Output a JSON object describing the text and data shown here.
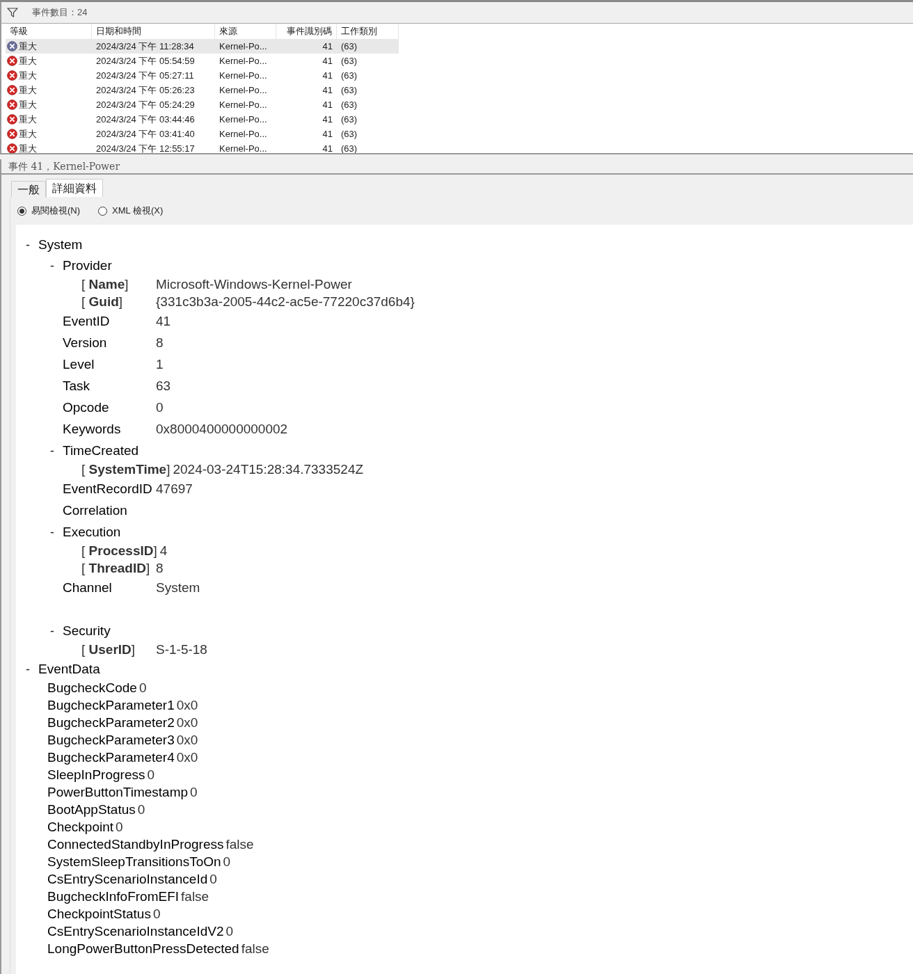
{
  "filter_bar": {
    "count_label": "事件數目：24"
  },
  "table": {
    "columns": [
      "等級",
      "日期和時間",
      "來源",
      "事件識別碼",
      "工作類別"
    ],
    "rows": [
      {
        "level": "重大",
        "datetime": "2024/3/24 下午 11:28:34",
        "source": "Kernel-Po...",
        "event_id": "41",
        "task": "(63)",
        "selected": true
      },
      {
        "level": "重大",
        "datetime": "2024/3/24 下午 05:54:59",
        "source": "Kernel-Po...",
        "event_id": "41",
        "task": "(63)",
        "selected": false
      },
      {
        "level": "重大",
        "datetime": "2024/3/24 下午 05:27:11",
        "source": "Kernel-Po...",
        "event_id": "41",
        "task": "(63)",
        "selected": false
      },
      {
        "level": "重大",
        "datetime": "2024/3/24 下午 05:26:23",
        "source": "Kernel-Po...",
        "event_id": "41",
        "task": "(63)",
        "selected": false
      },
      {
        "level": "重大",
        "datetime": "2024/3/24 下午 05:24:29",
        "source": "Kernel-Po...",
        "event_id": "41",
        "task": "(63)",
        "selected": false
      },
      {
        "level": "重大",
        "datetime": "2024/3/24 下午 03:44:46",
        "source": "Kernel-Po...",
        "event_id": "41",
        "task": "(63)",
        "selected": false
      },
      {
        "level": "重大",
        "datetime": "2024/3/24 下午 03:41:40",
        "source": "Kernel-Po...",
        "event_id": "41",
        "task": "(63)",
        "selected": false
      },
      {
        "level": "重大",
        "datetime": "2024/3/24 下午 12:55:17",
        "source": "Kernel-Po...",
        "event_id": "41",
        "task": "(63)",
        "selected": false
      }
    ]
  },
  "event_title": "事件 41，Kernel-Power",
  "tabs": [
    {
      "label": "一般",
      "selected": false
    },
    {
      "label": "詳細資料",
      "selected": true
    }
  ],
  "view_options": [
    {
      "label": "易閱檢視(N)",
      "selected": true
    },
    {
      "label": "XML 檢視(X)",
      "selected": false
    }
  ],
  "details": [
    {
      "kind": "group",
      "toggle": "-",
      "label": "System",
      "children": [
        {
          "kind": "group",
          "toggle": "-",
          "label": "Provider",
          "children": [
            {
              "kind": "attr",
              "label": "[ **Name**]",
              "value": "Microsoft-Windows-Kernel-Power"
            },
            {
              "kind": "attr",
              "label": "[ **Guid**]",
              "value": "{331c3b3a-2005-44c2-ac5e-77220c37d6b4}"
            }
          ]
        },
        {
          "kind": "field",
          "label": "EventID",
          "value": "41"
        },
        {
          "kind": "field",
          "label": "Version",
          "value": "8"
        },
        {
          "kind": "field",
          "label": "Level",
          "value": "1"
        },
        {
          "kind": "field",
          "label": "Task",
          "value": "63"
        },
        {
          "kind": "field",
          "label": "Opcode",
          "value": "0"
        },
        {
          "kind": "field",
          "label": "Keywords",
          "value": "0x8000400000000002"
        },
        {
          "kind": "group",
          "toggle": "-",
          "label": "TimeCreated",
          "children": [
            {
              "kind": "attr",
              "label": "[ **SystemTime**]",
              "value": "2024-03-24T15:28:34.7333524Z"
            }
          ]
        },
        {
          "kind": "field",
          "label": "EventRecordID",
          "value": "47697"
        },
        {
          "kind": "field",
          "label": "Correlation"
        },
        {
          "kind": "group",
          "toggle": "-",
          "label": "Execution",
          "children": [
            {
              "kind": "attr",
              "label": "[ **ProcessID**]",
              "value": "4"
            },
            {
              "kind": "attr",
              "label": "[ **ThreadID**]",
              "value": "8"
            }
          ]
        },
        {
          "kind": "field",
          "label": "Channel",
          "value": "System"
        },
        {
          "kind": "blank"
        },
        {
          "kind": "group",
          "toggle": "-",
          "label": "Security",
          "children": [
            {
              "kind": "attr",
              "label": "[ **UserID**]",
              "value": "S-1-5-18"
            }
          ]
        }
      ]
    },
    {
      "kind": "group",
      "toggle": "-",
      "label": "EventData",
      "children": [
        {
          "kind": "pair",
          "label": "BugcheckCode",
          "value": "0"
        },
        {
          "kind": "pair",
          "label": "BugcheckParameter1",
          "value": "0x0"
        },
        {
          "kind": "pair",
          "label": "BugcheckParameter2",
          "value": "0x0"
        },
        {
          "kind": "pair",
          "label": "BugcheckParameter3",
          "value": "0x0"
        },
        {
          "kind": "pair",
          "label": "BugcheckParameter4",
          "value": "0x0"
        },
        {
          "kind": "pair",
          "label": "SleepInProgress",
          "value": "0"
        },
        {
          "kind": "pair",
          "label": "PowerButtonTimestamp",
          "value": "0"
        },
        {
          "kind": "pair",
          "label": "BootAppStatus",
          "value": "0"
        },
        {
          "kind": "pair",
          "label": "Checkpoint",
          "value": "0"
        },
        {
          "kind": "pair",
          "label": "ConnectedStandbyInProgress",
          "value": "false"
        },
        {
          "kind": "pair",
          "label": "SystemSleepTransitionsToOn",
          "value": "0"
        },
        {
          "kind": "pair",
          "label": "CsEntryScenarioInstanceId",
          "value": "0"
        },
        {
          "kind": "pair",
          "label": "BugcheckInfoFromEFI",
          "value": "false"
        },
        {
          "kind": "pair",
          "label": "CheckpointStatus",
          "value": "0"
        },
        {
          "kind": "pair",
          "label": "CsEntryScenarioInstanceIdV2",
          "value": "0"
        },
        {
          "kind": "pair",
          "label": "LongPowerButtonPressDetected",
          "value": "false"
        }
      ]
    }
  ]
}
